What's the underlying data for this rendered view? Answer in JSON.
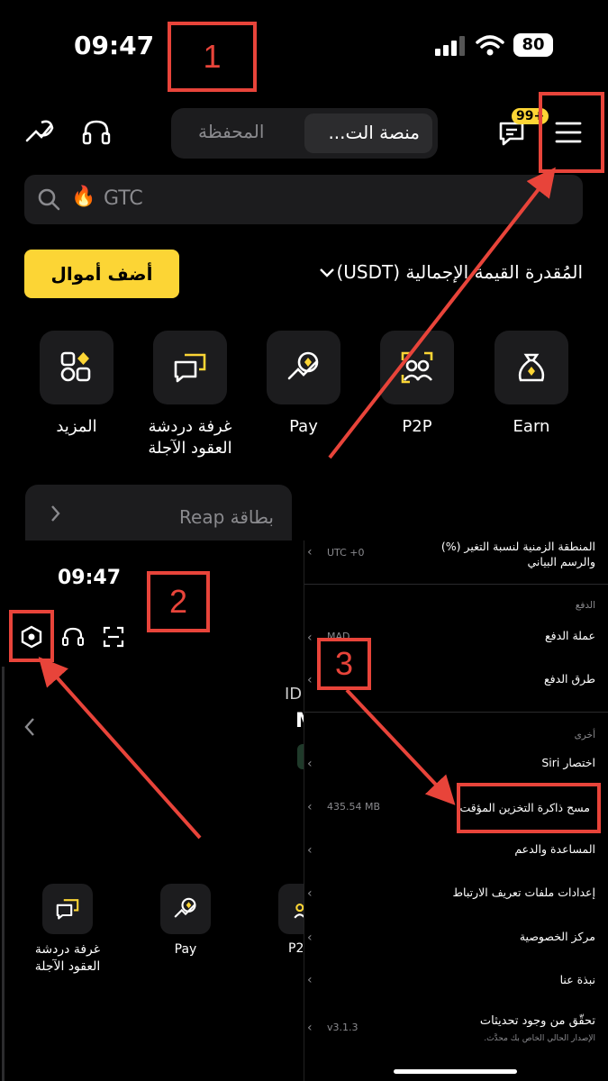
{
  "top": {
    "status_time": "09:47",
    "battery": "80",
    "badge": "99+",
    "tabs": {
      "wallet": "المحفظة",
      "exchange": "منصة الت..."
    },
    "search_text": "GTC",
    "search_emoji": "🔥",
    "add_funds": "أضف أموال",
    "balance_label": "المُقدرة القيمة الإجمالية (USDT)",
    "shortcuts": [
      {
        "label": "Earn",
        "icon": "bag-icon"
      },
      {
        "label": "P2P",
        "icon": "p2p-icon"
      },
      {
        "label": "Pay",
        "icon": "pay-icon"
      },
      {
        "label": "غرفة دردشة العقود الآجلة",
        "icon": "chat-icon"
      },
      {
        "label": "المزيد",
        "icon": "more-icon"
      }
    ],
    "reap_card": "بطاقة Reap"
  },
  "left_panel": {
    "status_time": "09:47",
    "id_partial": "ID:",
    "name_partial": "M",
    "shortcuts": [
      {
        "label": "غرفة دردشة العقود الآجلة"
      },
      {
        "label": "Pay"
      },
      {
        "label": "P2"
      }
    ]
  },
  "settings": {
    "timezone_label": "المنطقة الزمنية لنسبة التغير (%) والرسم البياني",
    "timezone_value": "UTC +0",
    "payment_section": "الدفع",
    "payment_currency": "عملة الدفع",
    "payment_currency_value": "MAD",
    "payment_methods": "طرق الدفع",
    "other_section": "أخرى",
    "siri": "اختصار Siri",
    "clear_cache": "مسح ذاكرة التخزين المؤقت",
    "cache_size": "435.54 MB",
    "help": "المساعدة والدعم",
    "link_settings": "إعدادات ملفات تعريف الارتباط",
    "privacy": "مركز الخصوصية",
    "about": "نبذة عنا",
    "check_updates": "تحقّق من وجود تحديثات",
    "version_note": "الإصدار الحالي الخاص بك محدَّث.",
    "version": "v3.1.3"
  },
  "annotations": [
    "1",
    "2",
    "3"
  ],
  "colors": {
    "accent": "#fcd535",
    "annotation": "#e8443a",
    "tile": "#1c1c1e"
  }
}
